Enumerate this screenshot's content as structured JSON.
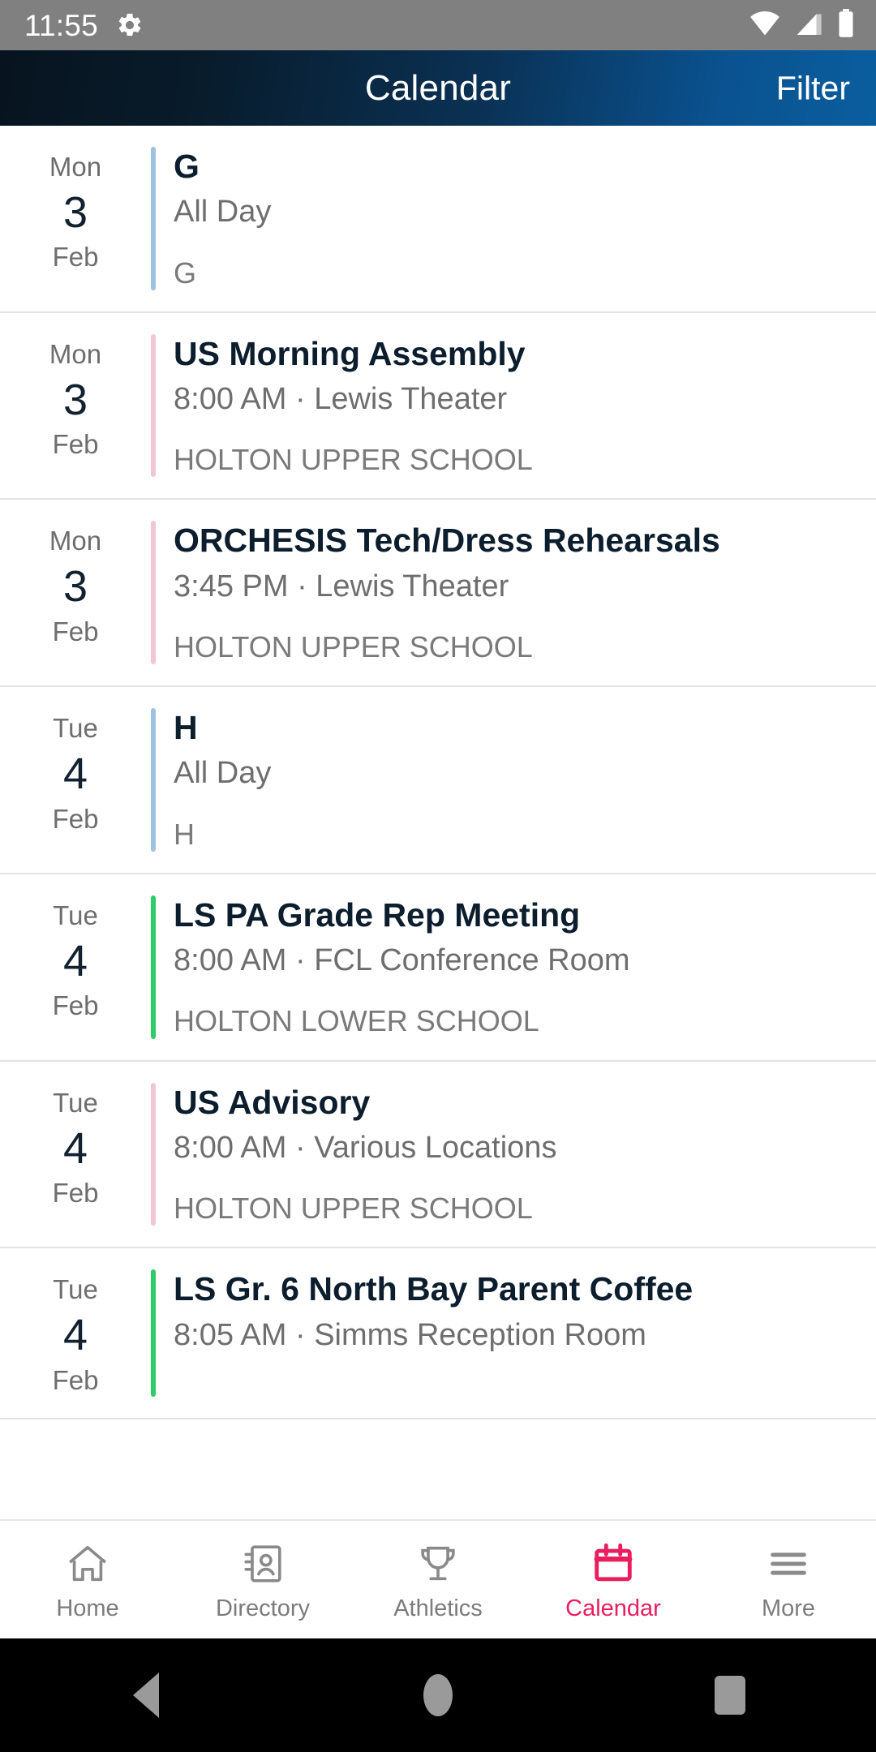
{
  "status_bar": {
    "time": "11:55",
    "icons": [
      "gear-icon",
      "wifi-icon",
      "cellular-signal-icon",
      "battery-icon"
    ]
  },
  "header": {
    "title": "Calendar",
    "action_label": "Filter",
    "gradient_from": "#07141f",
    "gradient_to": "#0a5e9e"
  },
  "colors": {
    "accent_blue": "#9dc3e0",
    "accent_pink": "#f2c6d2",
    "accent_green": "#2ecc66",
    "active_tab": "#ea1e5e",
    "title_text": "#0c1e2e",
    "muted_text": "#6e6e6e"
  },
  "events": [
    {
      "dow": "Mon",
      "day": "3",
      "month": "Feb",
      "title": "G",
      "subtitle": "All Day",
      "category": "G",
      "accent": "#9dc3e0"
    },
    {
      "dow": "Mon",
      "day": "3",
      "month": "Feb",
      "title": "US Morning Assembly",
      "subtitle": "8:00 AM · Lewis Theater",
      "category": "HOLTON UPPER SCHOOL",
      "accent": "#f2c6d2"
    },
    {
      "dow": "Mon",
      "day": "3",
      "month": "Feb",
      "title": "ORCHESIS Tech/Dress Rehearsals",
      "subtitle": "3:45 PM · Lewis Theater",
      "category": "HOLTON UPPER SCHOOL",
      "accent": "#f2c6d2"
    },
    {
      "dow": "Tue",
      "day": "4",
      "month": "Feb",
      "title": "H",
      "subtitle": "All Day",
      "category": "H",
      "accent": "#9dc3e0"
    },
    {
      "dow": "Tue",
      "day": "4",
      "month": "Feb",
      "title": "LS PA Grade Rep Meeting",
      "subtitle": "8:00 AM · FCL Conference Room",
      "category": "HOLTON LOWER SCHOOL",
      "accent": "#2ecc66"
    },
    {
      "dow": "Tue",
      "day": "4",
      "month": "Feb",
      "title": "US Advisory",
      "subtitle": "8:00 AM · Various Locations",
      "category": "HOLTON UPPER SCHOOL",
      "accent": "#f2c6d2"
    },
    {
      "dow": "Tue",
      "day": "4",
      "month": "Feb",
      "title": "LS Gr. 6 North Bay Parent Coffee",
      "subtitle": "8:05 AM · Simms Reception Room",
      "category": "",
      "accent": "#2ecc66"
    }
  ],
  "tabs": [
    {
      "label": "Home",
      "icon": "home-icon",
      "active": false
    },
    {
      "label": "Directory",
      "icon": "directory-icon",
      "active": false
    },
    {
      "label": "Athletics",
      "icon": "trophy-icon",
      "active": false
    },
    {
      "label": "Calendar",
      "icon": "calendar-icon",
      "active": true
    },
    {
      "label": "More",
      "icon": "hamburger-icon",
      "active": false
    }
  ],
  "android_nav": {
    "back": "back-triangle-icon",
    "home": "home-circle-icon",
    "recents": "recents-square-icon"
  }
}
